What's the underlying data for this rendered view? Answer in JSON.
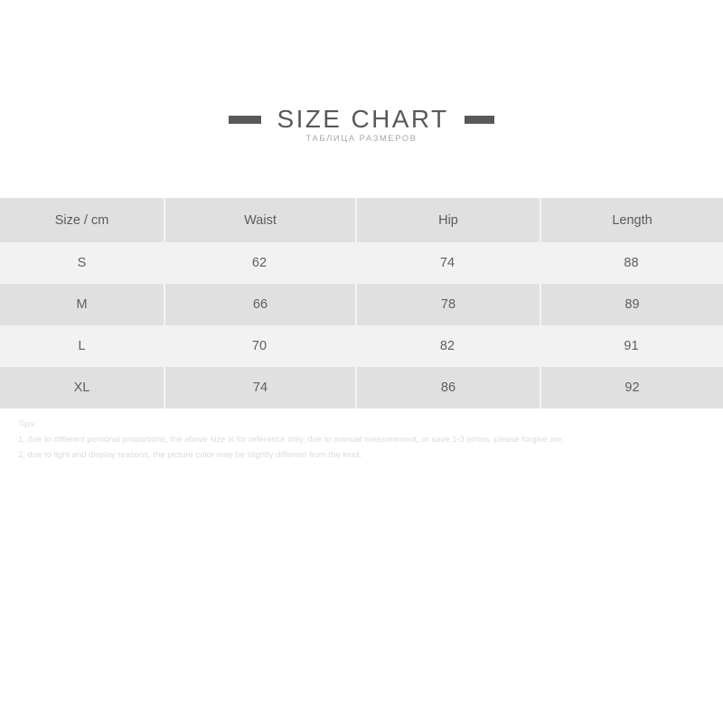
{
  "title": {
    "main": "SIZE CHART",
    "subtitle": "ТАБЛИЦА РАЗМЕРОВ"
  },
  "colors": {
    "page_background": "#ffffff",
    "title_text": "#595959",
    "title_bar": "#595959",
    "subtitle_text": "#a8a8a8",
    "row_dark": "#e0e0e0",
    "row_light": "#f2f2f2",
    "cell_text": "#5e5e5e",
    "divider": "#f4f4f4",
    "tips_text": "#dcdcdc"
  },
  "chart_data": {
    "type": "table",
    "title": "SIZE CHART",
    "columns": [
      "Size / cm",
      "Waist",
      "Hip",
      "Length"
    ],
    "rows": [
      {
        "size": "S",
        "waist": "62",
        "hip": "74",
        "length": "88"
      },
      {
        "size": "M",
        "waist": "66",
        "hip": "78",
        "length": "89"
      },
      {
        "size": "L",
        "waist": "70",
        "hip": "82",
        "length": "91"
      },
      {
        "size": "XL",
        "waist": "74",
        "hip": "86",
        "length": "92"
      }
    ],
    "units": "cm"
  },
  "tips": {
    "heading": "Tips:",
    "lines": [
      "1, due to different personal proportions, the above size is for reference only, due to manual measurement, or save 1-3 errors, please forgive me;",
      "2, due to light and display reasons, the picture color may be slightly different from the kind;"
    ]
  }
}
